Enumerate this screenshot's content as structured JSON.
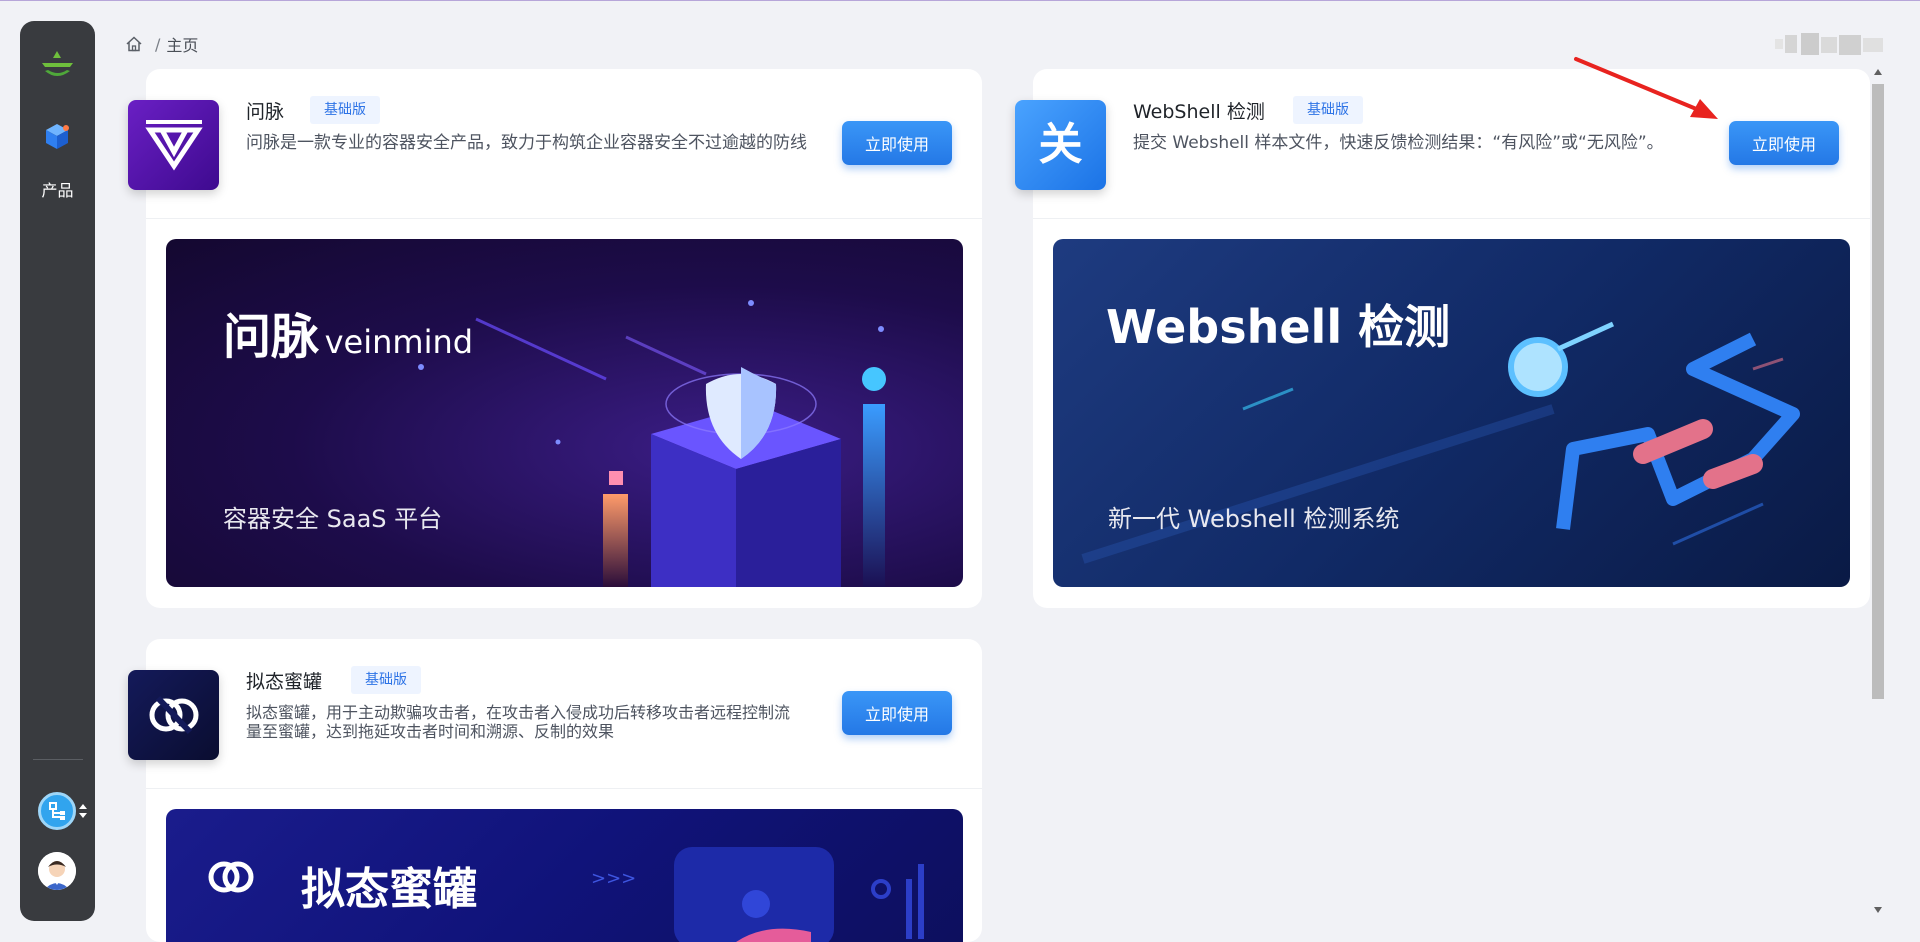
{
  "sidebar": {
    "nav": [
      {
        "label": "产品",
        "icon": "cube-icon"
      }
    ],
    "switch_icon": "switch-app-icon",
    "avatar_icon": "user-avatar"
  },
  "breadcrumb": {
    "home_icon": "home-icon",
    "separator": "/",
    "current": "主页"
  },
  "products": [
    {
      "title": "问脉",
      "badge": "基础版",
      "description": "问脉是一款专业的容器安全产品，致力于构筑企业容器安全不过逾越的防线",
      "button": "立即使用",
      "icon": "veinmind-logo-icon",
      "banner": {
        "title_cn": "问脉",
        "title_en": "veinmind",
        "subtitle": "容器安全 SaaS 平台"
      }
    },
    {
      "title": "WebShell 检测",
      "badge": "基础版",
      "description": "提交 Webshell 样本文件，快速反馈检测结果：“有风险”或“无风险”。",
      "button": "立即使用",
      "icon_text": "关",
      "banner": {
        "title": "Webshell 检测",
        "subtitle": "新一代 Webshell 检测系统"
      }
    },
    {
      "title": "拟态蜜罐",
      "badge": "基础版",
      "description_line1": "拟态蜜罐，用于主动欺骗攻击者，在攻击者入侵成功后转移攻击者远程控制流",
      "description_line2": "量至蜜罐，达到拖延攻击者时间和溯源、反制的效果",
      "button": "立即使用",
      "icon": "honeypot-logo-icon",
      "banner": {
        "title": "拟态蜜罐"
      }
    }
  ],
  "colors": {
    "accent": "#2478e6",
    "sidebar": "#393b3f",
    "background": "#f1f2f6"
  }
}
